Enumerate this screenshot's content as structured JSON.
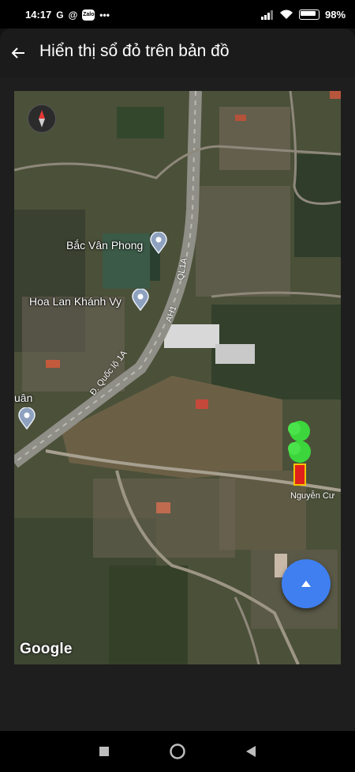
{
  "status_bar": {
    "time": "14:17",
    "left_icons": [
      "google-icon",
      "zalo-icon",
      "messenger-icon",
      "more-icon"
    ],
    "zalo_label": "Zalo",
    "battery": "98"
  },
  "header": {
    "title": "Hiển thị sổ đỏ trên bản đồ",
    "back_icon": "arrow-left-icon"
  },
  "map": {
    "places": [
      {
        "label": "Bắc Vân Phong"
      },
      {
        "label": "Hoa Lan Khánh Vy"
      },
      {
        "label": "uân"
      }
    ],
    "roads": [
      {
        "label": "Đ. Quốc lộ 1A"
      },
      {
        "label": "QL1A"
      },
      {
        "label": "AH1"
      },
      {
        "label": "Nguyễn Cư"
      }
    ],
    "attribution": "Google",
    "marker_color": "#3cd63c",
    "plot_color": "#e0201a",
    "fab_color": "#3f7ff0"
  },
  "nav_bar": {
    "buttons": [
      "recents-icon",
      "home-icon",
      "back-icon"
    ]
  }
}
